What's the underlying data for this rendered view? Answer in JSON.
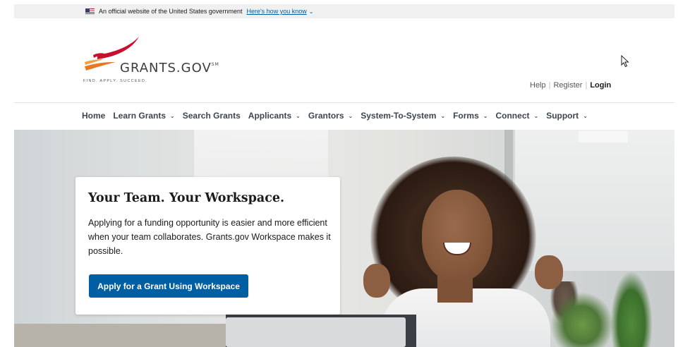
{
  "gov_banner": {
    "text": "An official website of the United States government",
    "link_text": "Here's how you know",
    "flag_icon": "us-flag-icon",
    "chevron_icon": "chevron-down-icon"
  },
  "header": {
    "logo_name": "GRANTS.GOV",
    "logo_mark": "SM",
    "logo_tagline": "FIND. APPLY. SUCCEED.",
    "utility_nav": {
      "help": "Help",
      "register": "Register",
      "login": "Login"
    }
  },
  "main_nav": {
    "items": [
      {
        "label": "Home",
        "has_dropdown": false
      },
      {
        "label": "Learn Grants",
        "has_dropdown": true
      },
      {
        "label": "Search Grants",
        "has_dropdown": false
      },
      {
        "label": "Applicants",
        "has_dropdown": true
      },
      {
        "label": "Grantors",
        "has_dropdown": true
      },
      {
        "label": "System-To-System",
        "has_dropdown": true
      },
      {
        "label": "Forms",
        "has_dropdown": true
      },
      {
        "label": "Connect",
        "has_dropdown": true
      },
      {
        "label": "Support",
        "has_dropdown": true
      }
    ],
    "chevron": "⌄"
  },
  "hero": {
    "title": "Your Team. Your Workspace.",
    "body": "Applying for a funding opportunity is easier and more efficient when your team collaborates. Grants.gov Workspace makes it possible.",
    "button_label": "Apply for a Grant Using Workspace"
  },
  "colors": {
    "primary_blue": "#005ea2",
    "nav_text": "#3d4551",
    "banner_bg": "#f0f0f0",
    "logo_orange": "#e87722",
    "logo_red": "#c8102e"
  }
}
